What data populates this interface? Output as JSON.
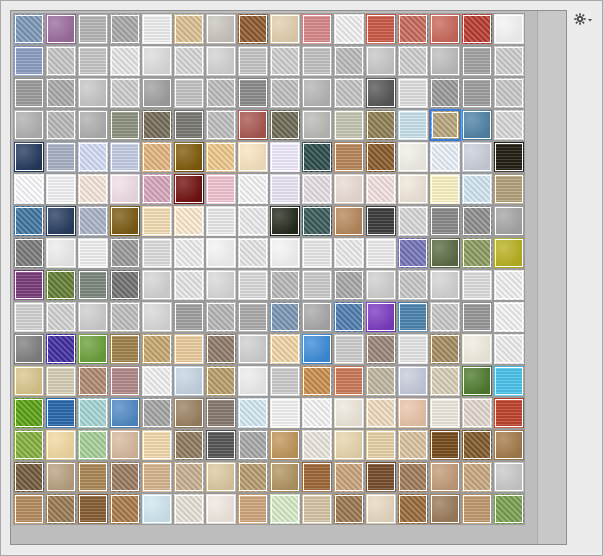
{
  "panel": {
    "menu_icon": "gear-flyout-icon",
    "selected_index": 61,
    "swatches": [
      "#7f98b8",
      "#9a6c9c",
      "#b8b8b8",
      "#a9a9a9",
      "#f1f1f1",
      "#dcc193",
      "#c9c5bd",
      "#8f5a2e",
      "#e2cfae",
      "#d98b8b",
      "#f2f2f2",
      "#cc5c4a",
      "#c86a5c",
      "#c9675a",
      "#b83b2f",
      "#f4f4f4",
      "#8ea0c4",
      "#c7c7c7",
      "#c9c9c9",
      "#e8e8e8",
      "#dcdcdc",
      "#d8d8d8",
      "#d2d2d2",
      "#c8c8c8",
      "#d0d0d0",
      "#c4c4c4",
      "#bcbcbc",
      "#c7c7c7",
      "#cfcfcf",
      "#bdbdbd",
      "#a5a5a5",
      "#cfcfcf",
      "#9e9e9e",
      "#aaaaaa",
      "#c6c6c6",
      "#cdcdcd",
      "#9f9f9f",
      "#c5c5c5",
      "#bdbdbd",
      "#8e8e8e",
      "#c0c0c0",
      "#b5b5b5",
      "#c4c4c4",
      "#555555",
      "#e2e2e2",
      "#9a9a9a",
      "#a0a0a0",
      "#c9c9c9",
      "#b0b0b0",
      "#b9b9b9",
      "#aeaeae",
      "#8f9582",
      "#756d5a",
      "#7c7a74",
      "#c0c0c0",
      "#a8564f",
      "#6d6a55",
      "#b9b9b5",
      "#c7c8b4",
      "#8d7f54",
      "#cbe3ee",
      "#b8a67e",
      "#4f82a6",
      "#d8d8d8",
      "#22385c",
      "#aab4c6",
      "#d5dcf6",
      "#c6cfe5",
      "#e4b57f",
      "#7f5a0a",
      "#efc98d",
      "#f8e3c0",
      "#f3eeff",
      "#2c4c4c",
      "#ba895c",
      "#8a5a2a",
      "#f1efe7",
      "#ecf1fa",
      "#c9ced9",
      "#242015",
      "#fdfdff",
      "#f5f5f8",
      "#f6e7db",
      "#f0dde6",
      "#d7a7bd",
      "#701010",
      "#f2c7d4",
      "#f6f6f6",
      "#ebe7f6",
      "#e6dfe6",
      "#e9dcd3",
      "#f4e2e2",
      "#efe6d9",
      "#fcf5c6",
      "#d2e6f1",
      "#b6a47e",
      "#3f75a0",
      "#263b5e",
      "#aab4c6",
      "#7a5a12",
      "#f4dfb7",
      "#fcebd2",
      "#ededed",
      "#ededed",
      "#232a1c",
      "#3a5a5a",
      "#b6875b",
      "#3f3f3f",
      "#d8d8d8",
      "#8c8c8c",
      "#8f8f8f",
      "#a5a5a5",
      "#7a7a7a",
      "#ececec",
      "#f2f2f2",
      "#9a9a9a",
      "#dfdfdf",
      "#efefef",
      "#f3f3f3",
      "#e8e8e8",
      "#f4f4f4",
      "#ebebeb",
      "#ededed",
      "#efefef",
      "#7575b8",
      "#5a6a44",
      "#8c9c60",
      "#b8b020",
      "#7b3f7b",
      "#647f34",
      "#7f8a7f",
      "#727272",
      "#d3d3d3",
      "#e8e8e8",
      "#d8d8d8",
      "#dddddd",
      "#b8b8b8",
      "#cdcdcd",
      "#a8a8a8",
      "#cfcfcf",
      "#c7c7c7",
      "#d2d2d2",
      "#dfdfdf",
      "#f2f2f2",
      "#d5d5d5",
      "#d3d3d3",
      "#cdcdcd",
      "#bfbfbf",
      "#d8d8d8",
      "#a3a3a3",
      "#b7b7b7",
      "#aeaeae",
      "#7d97b4",
      "#a8a8a8",
      "#4f7db0",
      "#7a3ac0",
      "#4f86b0",
      "#c9c9c9",
      "#9a9a9a",
      "#f4f4f4",
      "#7f7f7f",
      "#3f2da0",
      "#6aa03a",
      "#a0854f",
      "#c6a86f",
      "#edcfa0",
      "#8f7a6a",
      "#cfcfcf",
      "#f1d7a8",
      "#3b8bd8",
      "#d0d0d0",
      "#9a8679",
      "#e7e7e7",
      "#a58c62",
      "#f1ecdf",
      "#efefef",
      "#d9c58c",
      "#d8d0b8",
      "#b08a72",
      "#b48c8c",
      "#f2f2f2",
      "#c6d4e2",
      "#b89f6a",
      "#ececec",
      "#cfcfcf",
      "#c98e4f",
      "#cd7c5a",
      "#c0b6a0",
      "#c6cbdb",
      "#d8cfb8",
      "#4e7a2e",
      "#4ec6ee",
      "#5aa012",
      "#2c6aae",
      "#a6d6d6",
      "#4f89c4",
      "#a6a6a6",
      "#9a8060",
      "#8a7c72",
      "#d5e9f3",
      "#f6f6f6",
      "#f6f6f6",
      "#ede7da",
      "#f0dcc0",
      "#e8c3a8",
      "#efeade",
      "#e2d8d0",
      "#c0452f",
      "#86b040",
      "#f0d8a0",
      "#a8d09a",
      "#d7b99d",
      "#f4dcb0",
      "#8f7a5f",
      "#585858",
      "#a8a8a8",
      "#c0955a",
      "#ece7e0",
      "#e7d5ac",
      "#e8d3a8",
      "#dbc3a0",
      "#7a4e1f",
      "#7f5a2a",
      "#a37a4a",
      "#735a3a",
      "#b8a080",
      "#ad8a5a",
      "#9a7a60",
      "#d8b890",
      "#c8b090",
      "#dcc9a0",
      "#b89c70",
      "#b09460",
      "#a06a3a",
      "#c8a47a",
      "#7a5030",
      "#a07a5a",
      "#c29b78",
      "#c8a880",
      "#c9c9c9",
      "#b78f62",
      "#9a7a52",
      "#8a6038",
      "#aa7a4a",
      "#d0e6f0",
      "#e8e2d8",
      "#f0e8e0",
      "#d0a880",
      "#d8ecc8",
      "#d8c8a8",
      "#9a7850",
      "#e8d8c0",
      "#9a6a3a",
      "#9a7a5a",
      "#c29c72",
      "#7aa050"
    ]
  }
}
